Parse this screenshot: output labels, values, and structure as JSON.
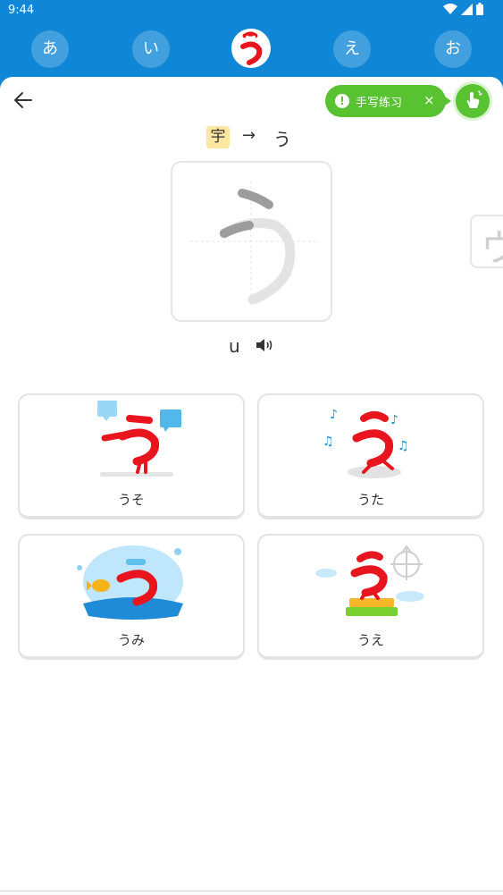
{
  "status_bar": {
    "time": "9:44"
  },
  "kana_tabs": [
    {
      "label": "あ"
    },
    {
      "label": "い"
    },
    {
      "label": "う",
      "active": true
    },
    {
      "label": "え"
    },
    {
      "label": "お"
    }
  ],
  "handwriting": {
    "label": "手写练习",
    "close": "×"
  },
  "origin": {
    "kanji": "宇",
    "arrow": "→",
    "kana": "う"
  },
  "practice": {
    "character": "う",
    "next_character": "ウ",
    "romaji": "u"
  },
  "words": [
    {
      "word": "うそ"
    },
    {
      "word": "うた"
    },
    {
      "word": "うみ"
    },
    {
      "word": "うえ"
    }
  ],
  "colors": {
    "primary_blue": "#0f86d6",
    "accent_green": "#58c230",
    "mascot_red": "#e8141e",
    "kanji_highlight": "#fbe7a0"
  },
  "icons": [
    "back-arrow-icon",
    "alert-icon",
    "close-icon",
    "hand-pointer-icon",
    "speaker-icon",
    "wifi-icon",
    "signal-icon",
    "battery-icon"
  ]
}
